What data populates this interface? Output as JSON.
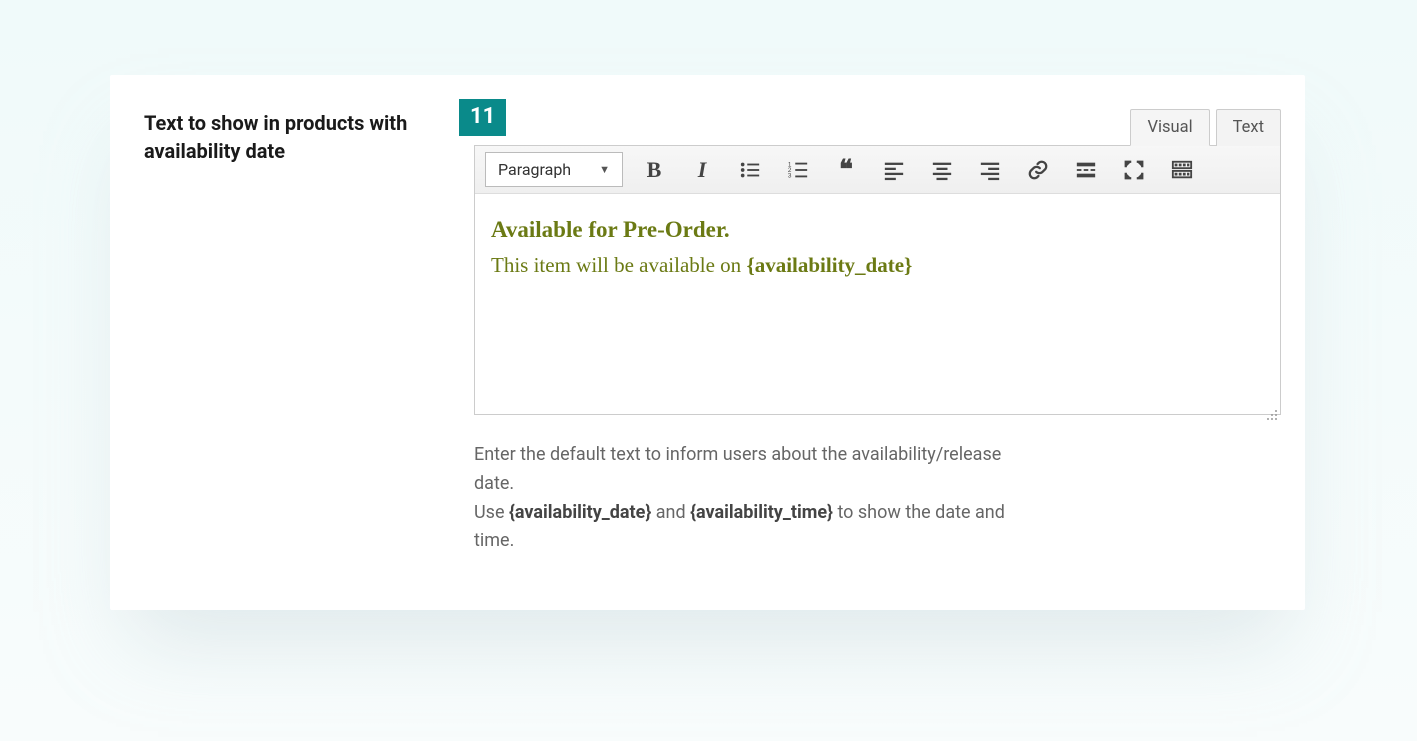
{
  "field": {
    "label": "Text to show in products with availability date",
    "badge": "11"
  },
  "editor": {
    "tabs": {
      "visual": "Visual",
      "text": "Text",
      "active": "visual"
    },
    "format_selector": "Paragraph",
    "content": {
      "line1": "Available for Pre-Order.",
      "line2_prefix": "This item will be available on ",
      "line2_placeholder": "{availability_date}"
    }
  },
  "help": {
    "p1": "Enter the default text to inform users about the availability/release date.",
    "p2_prefix": "Use ",
    "p2_ph1": "{availability_date}",
    "p2_mid": " and ",
    "p2_ph2": "{availability_time}",
    "p2_suffix": " to show the date and time."
  },
  "icons": {
    "bold": "bold-icon",
    "italic": "italic-icon",
    "ul": "bullet-list-icon",
    "ol": "numbered-list-icon",
    "quote": "blockquote-icon",
    "align_left": "align-left-icon",
    "align_center": "align-center-icon",
    "align_right": "align-right-icon",
    "link": "link-icon",
    "readmore": "read-more-icon",
    "fullscreen": "fullscreen-icon",
    "toolbar_toggle": "toolbar-toggle-icon"
  }
}
